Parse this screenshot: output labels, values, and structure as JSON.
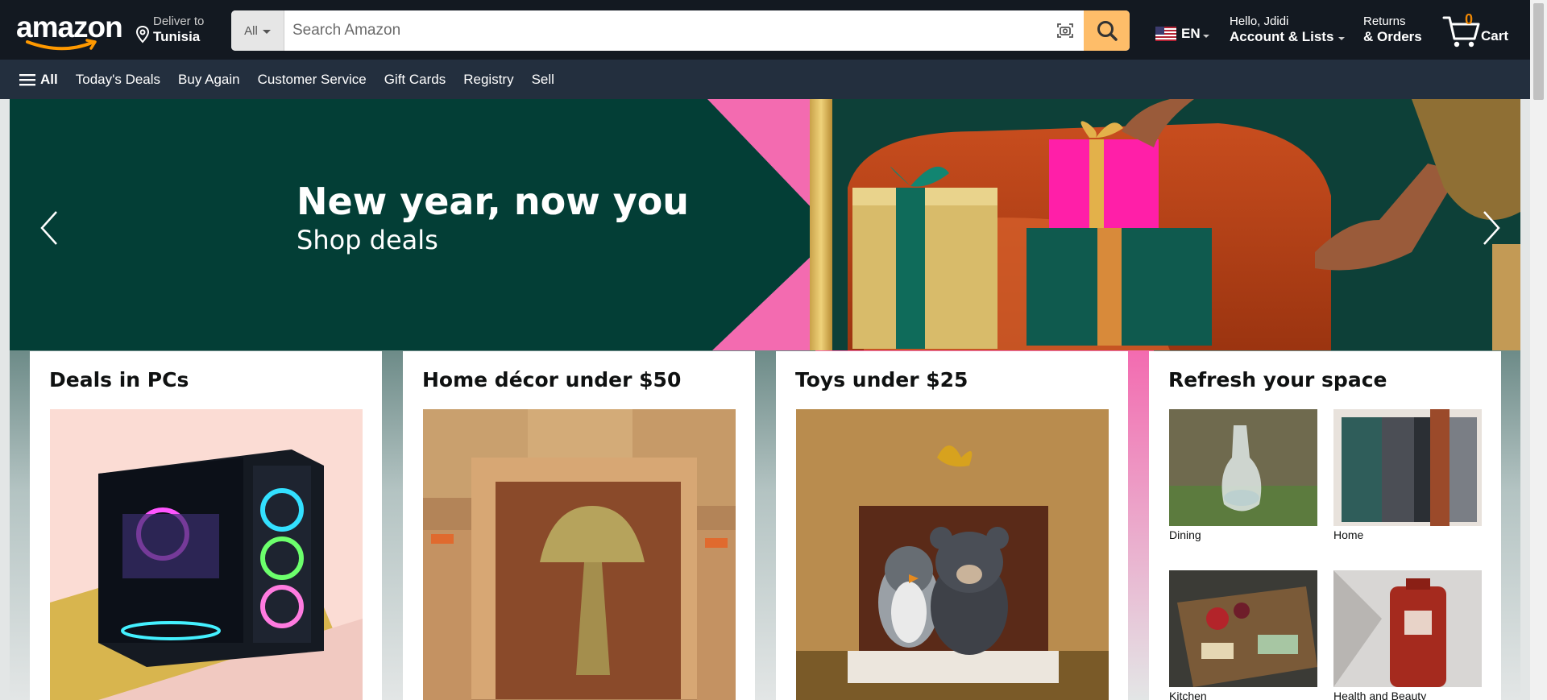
{
  "header": {
    "logo_text": "amazon",
    "deliver_to_label": "Deliver to",
    "deliver_to_location": "Tunisia",
    "search": {
      "category": "All",
      "placeholder": "Search Amazon",
      "value": ""
    },
    "language": "EN",
    "account_greeting": "Hello, Jdidi",
    "account_label": "Account & Lists",
    "returns_label": "Returns",
    "orders_label": "& Orders",
    "cart_count": "0",
    "cart_label": "Cart"
  },
  "subnav": {
    "all_label": "All",
    "links": [
      "Today's Deals",
      "Buy Again",
      "Customer Service",
      "Gift Cards",
      "Registry",
      "Sell"
    ]
  },
  "hero": {
    "title": "New year, now you",
    "subtitle": "Shop deals"
  },
  "cards": [
    {
      "title": "Deals in PCs"
    },
    {
      "title": "Home décor under $50"
    },
    {
      "title": "Toys under $25"
    },
    {
      "title": "Refresh your space",
      "tiles": [
        "Dining",
        "Home",
        "Kitchen",
        "Health and Beauty"
      ]
    }
  ],
  "colors": {
    "nav_top": "#131921",
    "nav_sub": "#232f3e",
    "search_button": "#febd69",
    "cart_count": "#f08804",
    "hero_green": "#033e36",
    "hero_pink": "#f36bb0"
  }
}
